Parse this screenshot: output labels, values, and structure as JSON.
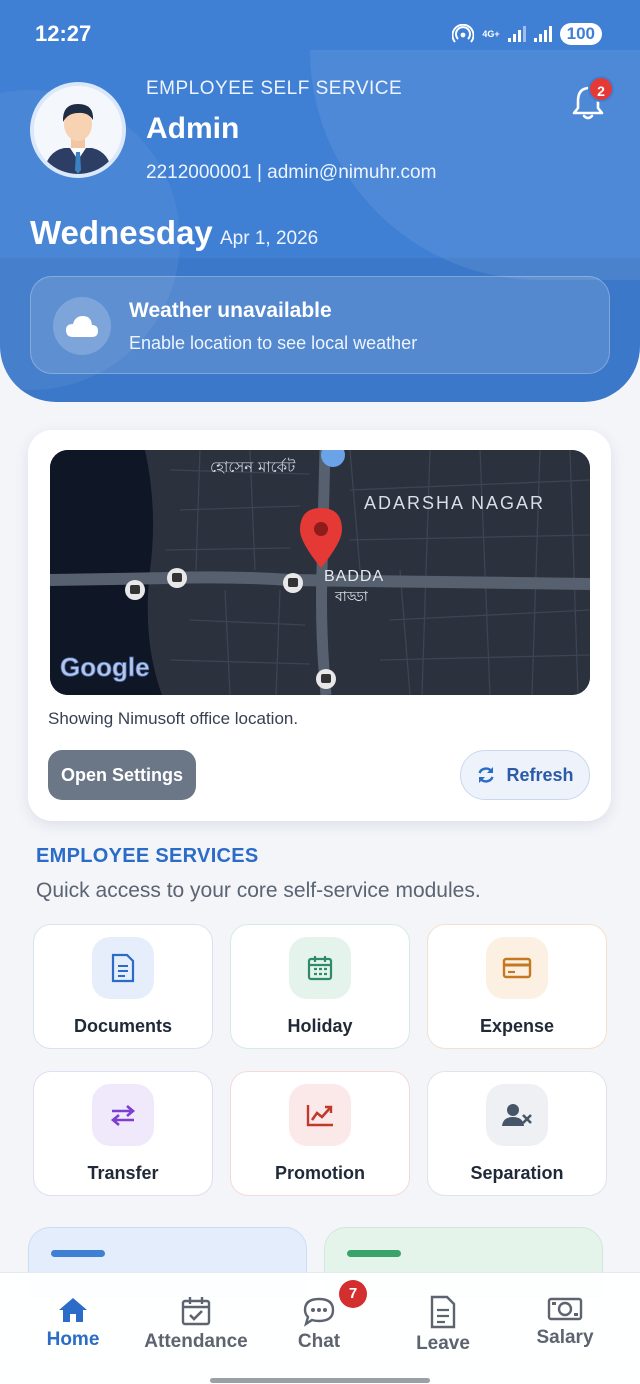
{
  "status": {
    "time": "12:27",
    "network": "4G+",
    "battery": "100"
  },
  "header": {
    "label": "EMPLOYEE SELF SERVICE",
    "name": "Admin",
    "contact": "2212000001 | admin@nimuhr.com",
    "notification_count": "2",
    "day": "Wednesday",
    "date": "Apr 1, 2026"
  },
  "weather": {
    "title": "Weather unavailable",
    "subtitle": "Enable location to see local weather",
    "icon": "cloud-icon"
  },
  "map": {
    "labels": {
      "market": "হোসেন মার্কেট",
      "area": "ADARSHA NAGAR",
      "place_en": "BADDA",
      "place_bn": "বাড্ডা",
      "google": "Google"
    },
    "caption": "Showing Nimusoft office location.",
    "settings_label": "Open Settings",
    "refresh_label": "Refresh"
  },
  "services": {
    "title": "EMPLOYEE SERVICES",
    "subtitle": "Quick access to your core self-service modules.",
    "items": [
      {
        "label": "Documents",
        "icon": "document-icon",
        "color": "#2a6cc7"
      },
      {
        "label": "Holiday",
        "icon": "calendar-icon",
        "color": "#2e8b6a"
      },
      {
        "label": "Expense",
        "icon": "credit-card-icon",
        "color": "#c7771f"
      },
      {
        "label": "Transfer",
        "icon": "transfer-icon",
        "color": "#7b3fd4"
      },
      {
        "label": "Promotion",
        "icon": "trending-up-icon",
        "color": "#c0392b"
      },
      {
        "label": "Separation",
        "icon": "user-remove-icon",
        "color": "#475569"
      }
    ]
  },
  "nav": {
    "items": [
      {
        "label": "Home",
        "icon": "home-icon",
        "active": true
      },
      {
        "label": "Attendance",
        "icon": "calendar-check-icon"
      },
      {
        "label": "Chat",
        "icon": "chat-icon",
        "badge": "7"
      },
      {
        "label": "Leave",
        "icon": "document-icon"
      },
      {
        "label": "Salary",
        "icon": "money-icon"
      }
    ]
  }
}
